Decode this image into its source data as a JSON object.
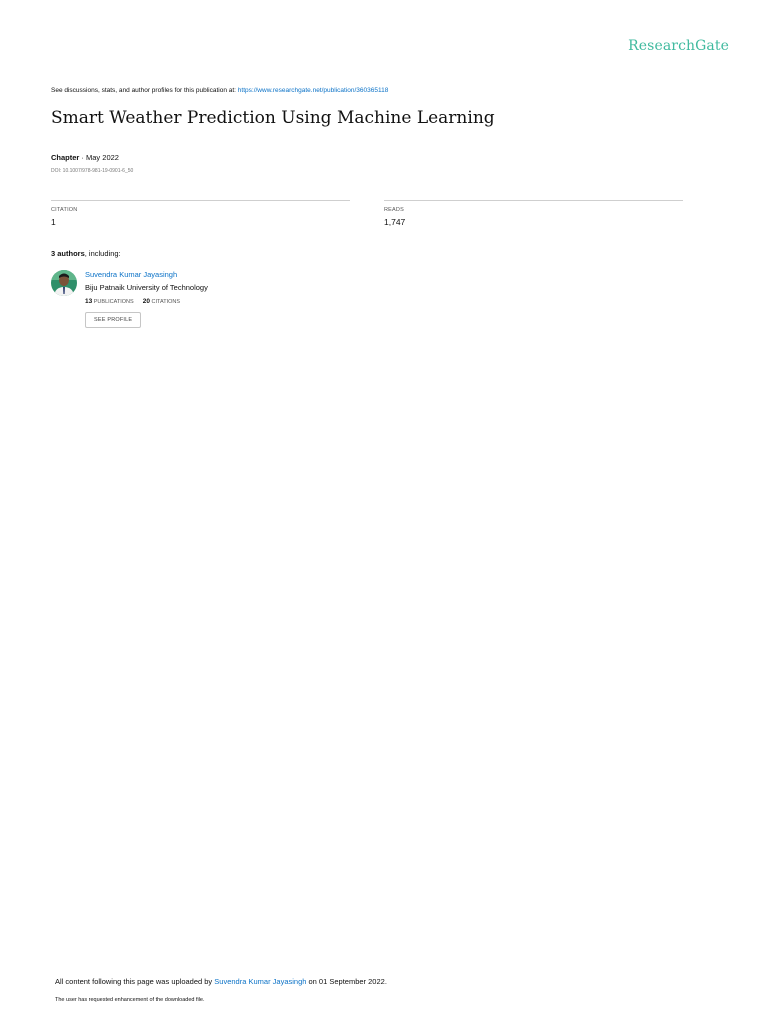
{
  "header": {
    "brand": "ResearchGate"
  },
  "discussion": {
    "text": "See discussions, stats, and author profiles for this publication at: ",
    "url": "https://www.researchgate.net/publication/360365118"
  },
  "publication": {
    "title": "Smart Weather Prediction Using Machine Learning",
    "kind": "Chapter",
    "separator": " · ",
    "date": "May 2022",
    "doi": "DOI: 10.1007/978-981-19-0901-6_50"
  },
  "stats": {
    "citation_label": "CITATION",
    "citation_value": "1",
    "reads_label": "READS",
    "reads_value": "1,747"
  },
  "authors": {
    "count_text": "3 authors",
    "suffix": ", including:",
    "list": [
      {
        "name": "Suvendra Kumar Jayasingh",
        "affiliation": "Biju Patnaik University of Technology",
        "publications_count": "13",
        "publications_label": "PUBLICATIONS",
        "citations_count": "20",
        "citations_label": "CITATIONS",
        "profile_button": "SEE PROFILE"
      }
    ]
  },
  "footer": {
    "uploaded_prefix": "All content following this page was uploaded by ",
    "uploader": "Suvendra Kumar Jayasingh",
    "uploaded_suffix": " on 01 September 2022.",
    "note": "The user has requested enhancement of the downloaded file."
  },
  "colors": {
    "brand": "#40ba9f",
    "link": "#0b72c7"
  }
}
